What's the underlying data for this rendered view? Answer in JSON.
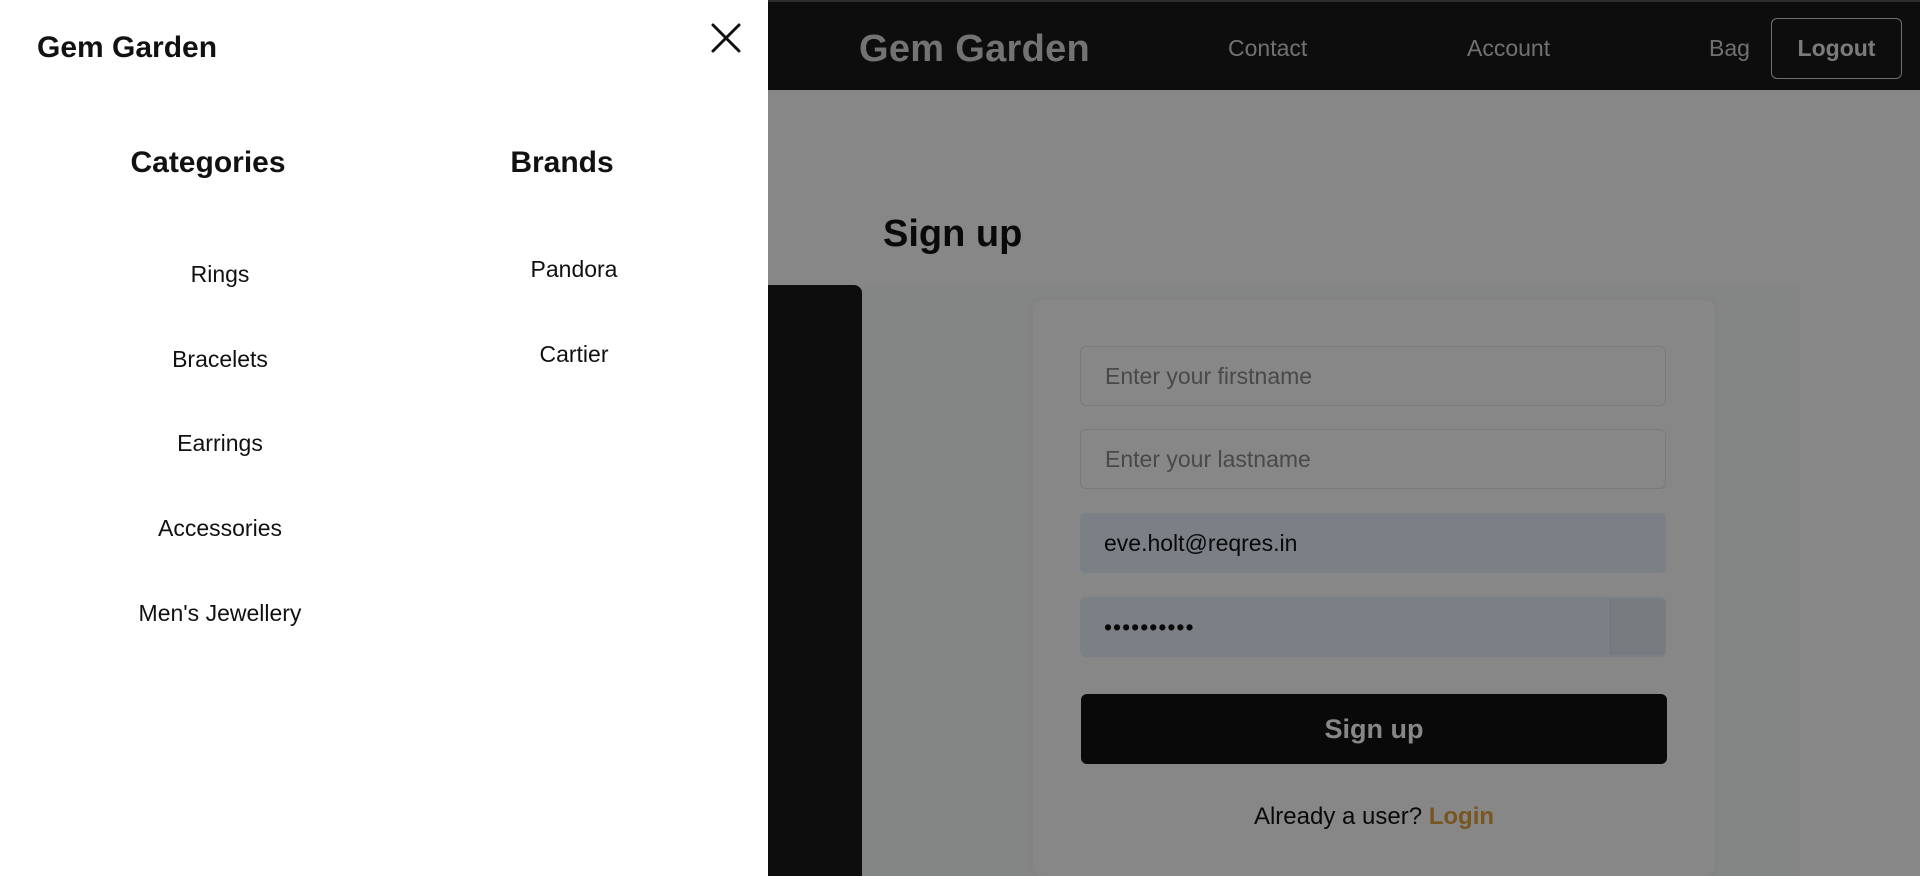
{
  "navbar": {
    "brand": "Gem Garden",
    "links": [
      "Contact",
      "Account",
      "Bag"
    ],
    "logout_label": "Logout"
  },
  "signup": {
    "title": "Sign up",
    "firstname_placeholder": "Enter your firstname",
    "lastname_placeholder": "Enter your lastname",
    "email_value": "eve.holt@reqres.in",
    "password_value": "••••••••••",
    "submit_label": "Sign up",
    "login_prompt": "Already a user?",
    "login_link": "Login"
  },
  "drawer": {
    "title": "Gem Garden",
    "close_icon": "close-icon",
    "categories": {
      "heading": "Categories",
      "items": [
        "Rings",
        "Bracelets",
        "Earrings",
        "Accessories",
        "Men's Jewellery"
      ]
    },
    "brands": {
      "heading": "Brands",
      "items": [
        "Pandora",
        "Cartier"
      ]
    }
  },
  "colors": {
    "navbar_bg": "#1a1a1a",
    "login_link": "#e2a23e",
    "autofill_bg": "#e8f0fe",
    "overlay": "rgba(0,0,0,0.47)"
  }
}
